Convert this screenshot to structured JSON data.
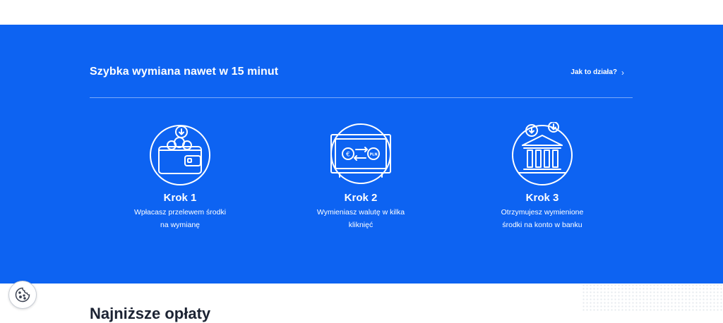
{
  "hero": {
    "title": "Szybka wymiana nawet w 15 minut",
    "how_link": "Jak to działa?",
    "steps": [
      {
        "title": "Krok 1",
        "desc": "Wpłacasz przelewem środki na wymianę",
        "icon": "wallet-icon"
      },
      {
        "title": "Krok 2",
        "desc": "Wymieniasz walutę w kilka kliknięć",
        "icon": "exchange-icon"
      },
      {
        "title": "Krok 3",
        "desc": "Otrzymujesz wymienione środki na konto w banku",
        "icon": "bank-icon"
      }
    ],
    "exchange_labels": {
      "from": "€",
      "to": "PLN"
    }
  },
  "next_section": {
    "heading": "Najniższe opłaty"
  },
  "colors": {
    "brand_blue": "#0d63f2",
    "text_dark": "#1c2333"
  },
  "cookie": {
    "icon": "cookie-icon"
  }
}
